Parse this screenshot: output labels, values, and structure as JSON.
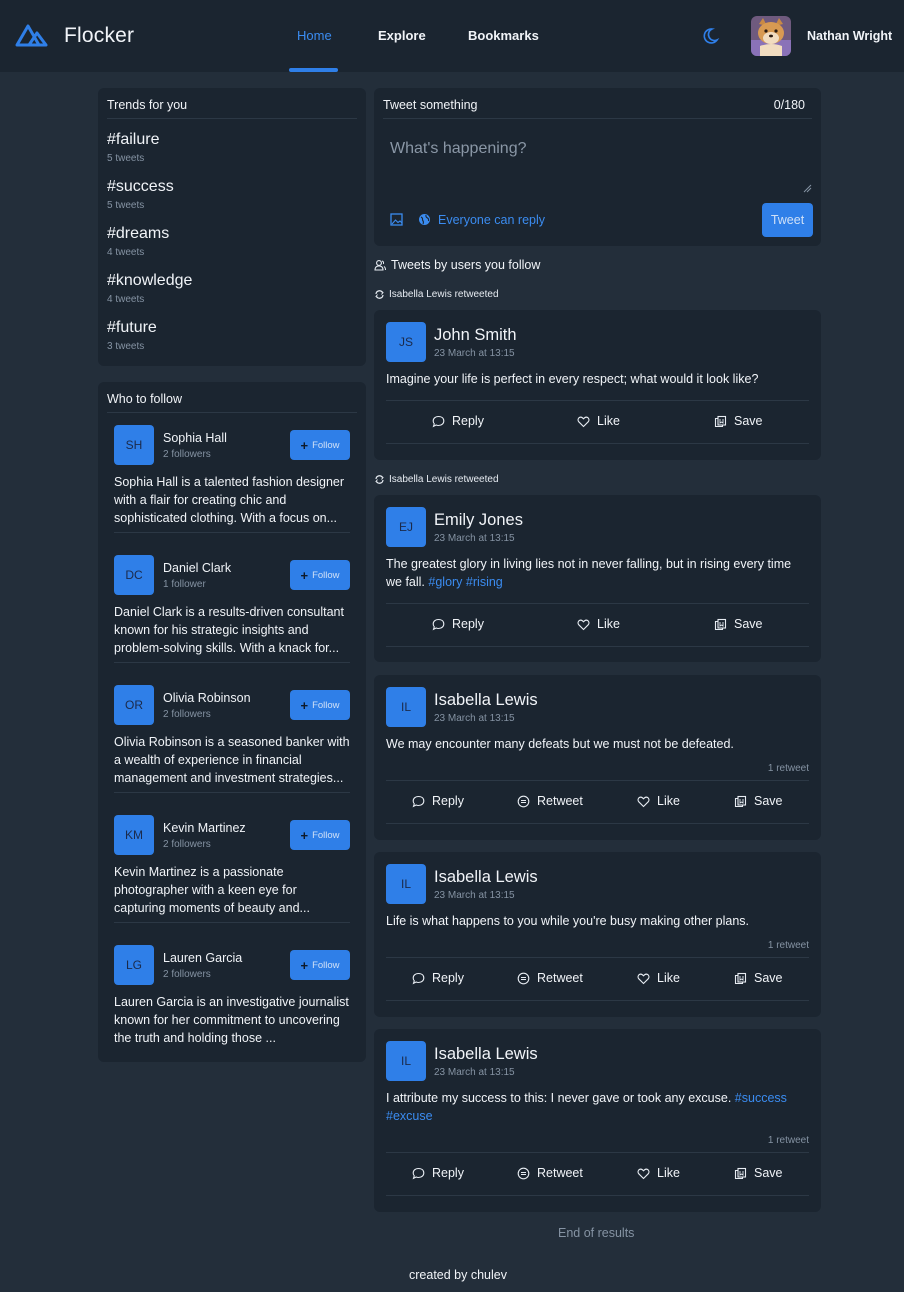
{
  "header": {
    "brand": "Flocker",
    "nav": {
      "home": "Home",
      "explore": "Explore",
      "bookmarks": "Bookmarks"
    },
    "user_name": "Nathan Wright",
    "accent_color": "#2f7fe8"
  },
  "trends": {
    "title": "Trends for you",
    "items": [
      {
        "tag": "#failure",
        "count": "5 tweets"
      },
      {
        "tag": "#success",
        "count": "5 tweets"
      },
      {
        "tag": "#dreams",
        "count": "4 tweets"
      },
      {
        "tag": "#knowledge",
        "count": "4 tweets"
      },
      {
        "tag": "#future",
        "count": "3 tweets"
      }
    ]
  },
  "who_to_follow": {
    "title": "Who to follow",
    "follow_label": "Follow",
    "people": [
      {
        "initials": "SH",
        "name": "Sophia Hall",
        "followers": "2 followers",
        "bio": "Sophia Hall is a talented fashion designer with a flair for creating chic and sophisticated clothing. With a focus on..."
      },
      {
        "initials": "DC",
        "name": "Daniel Clark",
        "followers": "1 follower",
        "bio": "Daniel Clark is a results-driven consultant known for his strategic insights and problem-solving skills. With a knack for..."
      },
      {
        "initials": "OR",
        "name": "Olivia Robinson",
        "followers": "2 followers",
        "bio": "Olivia Robinson is a seasoned banker with a wealth of experience in financial management and investment strategies..."
      },
      {
        "initials": "KM",
        "name": "Kevin Martinez",
        "followers": "2 followers",
        "bio": "Kevin Martinez is a passionate photographer with a keen eye for capturing moments of beauty and..."
      },
      {
        "initials": "LG",
        "name": "Lauren Garcia",
        "followers": "2 followers",
        "bio": "Lauren Garcia is an investigative journalist known for her commitment to uncovering the truth and holding those ..."
      }
    ]
  },
  "composer": {
    "title": "Tweet something",
    "counter": "0/180",
    "placeholder": "What's happening?",
    "reply_setting": "Everyone can reply",
    "submit_label": "Tweet"
  },
  "feed": {
    "title": "Tweets by users you follow",
    "end_text": "End of results",
    "actions": {
      "reply": "Reply",
      "retweet": "Retweet",
      "like": "Like",
      "save": "Save"
    },
    "tweets": [
      {
        "retweet_note": "Isabella Lewis retweeted",
        "initials": "JS",
        "author": "John Smith",
        "time": "23 March at 13:15",
        "text": "Imagine your life is perfect in every respect; what would it look like?",
        "hashtags": [],
        "retweets": ""
      },
      {
        "retweet_note": "Isabella Lewis retweeted",
        "initials": "EJ",
        "author": "Emily Jones",
        "time": "23 March at 13:15",
        "text": "The greatest glory in living lies not in never falling, but in rising every time we fall.",
        "hashtags": [
          "#glory",
          "#rising"
        ],
        "retweets": ""
      },
      {
        "retweet_note": "",
        "initials": "IL",
        "author": "Isabella Lewis",
        "time": "23 March at 13:15",
        "text": "We may encounter many defeats but we must not be defeated.",
        "hashtags": [],
        "retweets": "1 retweet"
      },
      {
        "retweet_note": "",
        "initials": "IL",
        "author": "Isabella Lewis",
        "time": "23 March at 13:15",
        "text": "Life is what happens to you while you're busy making other plans.",
        "hashtags": [],
        "retweets": "1 retweet"
      },
      {
        "retweet_note": "",
        "initials": "IL",
        "author": "Isabella Lewis",
        "time": "23 March at 13:15",
        "text": "I attribute my success to this: I never gave or took any excuse.",
        "hashtags": [
          "#success",
          "#excuse"
        ],
        "retweets": "1 retweet"
      }
    ]
  },
  "footer": {
    "text": "created by chulev"
  }
}
